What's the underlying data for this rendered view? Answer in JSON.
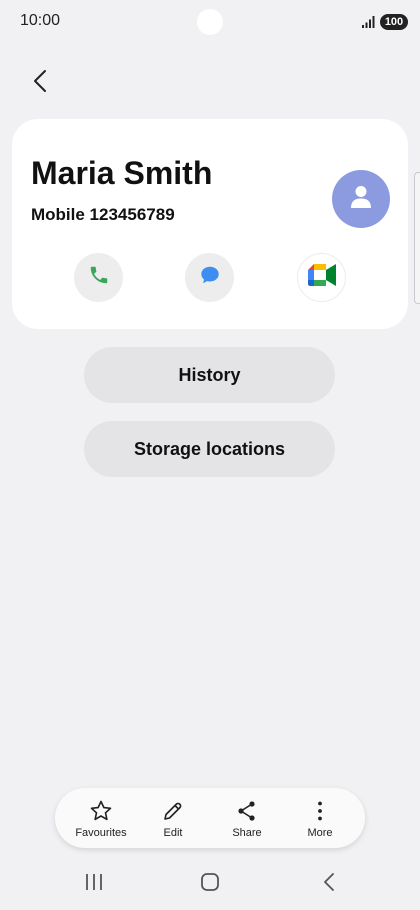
{
  "status_bar": {
    "time": "10:00",
    "battery": "100",
    "signal_icon": "signal-bars-icon"
  },
  "header": {
    "back_icon": "chevron-left-icon"
  },
  "contact": {
    "name": "Maria Smith",
    "number_line": "Mobile 123456789",
    "avatar_icon": "person-icon",
    "avatar_color": "#8c9be0"
  },
  "actions": {
    "call_icon": "phone-icon",
    "call_color": "#3aa55b",
    "message_icon": "message-bubble-icon",
    "message_color": "#3d8ef0",
    "video_icon": "video-call-icon"
  },
  "buttons": {
    "history": "History",
    "storage": "Storage locations"
  },
  "toolbar": {
    "favourites": "Favourites",
    "edit": "Edit",
    "share": "Share",
    "more": "More"
  },
  "nav": {
    "recents_icon": "recents-icon",
    "home_icon": "home-icon",
    "back_icon": "back-icon"
  }
}
